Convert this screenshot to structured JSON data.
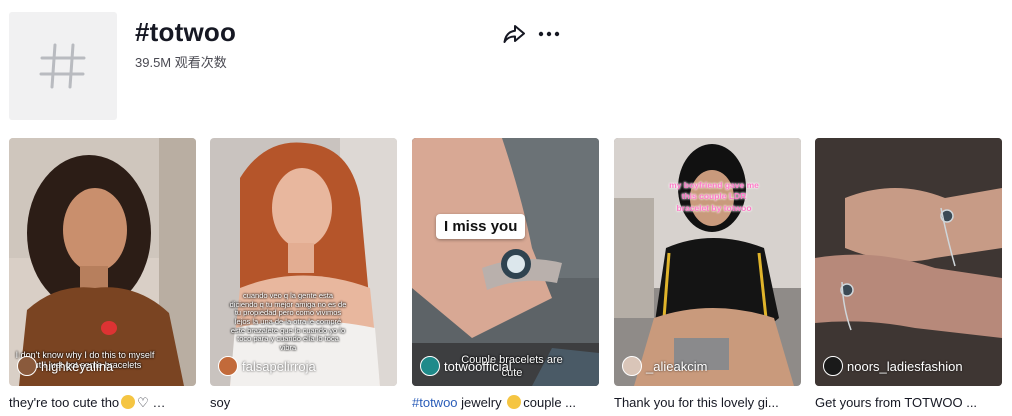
{
  "header": {
    "title": "#totwoo",
    "views": "39.5M 观看次数",
    "share_icon": "share-arrow-icon",
    "more_icon": "more-dots-icon"
  },
  "videos": [
    {
      "author": "highkeyalina",
      "caption": "they're too cute tho",
      "caption_suffix": "…",
      "overlay_text": "I don't know why I do this to myself but I just got some bracelets"
    },
    {
      "author": "falsapelirroja",
      "caption": "soy",
      "overlay_text": "cuando veo q la gente esta diciendo q tu mejor amiga no es de tu propiedad pero como vivimos lejos la una de la otra le compré este brazalete que lo cuando yo lo toco para y cuando ella lo toca vibra"
    },
    {
      "author": "totwoofficial",
      "caption_tag": "#totwoo",
      "caption": " jewelry ",
      "caption_rest": "couple ...",
      "overlay_label": "I miss you",
      "overlay_text": "Couple bracelets are cute"
    },
    {
      "author": "_alieakcim",
      "caption": "Thank you for this lovely gi...",
      "overlay_text": "my boyfriend gave me this couple LDR bracelet by totwoo"
    },
    {
      "author": "noors_ladiesfashion",
      "caption": "Get yours from TOTWOO ..."
    }
  ]
}
